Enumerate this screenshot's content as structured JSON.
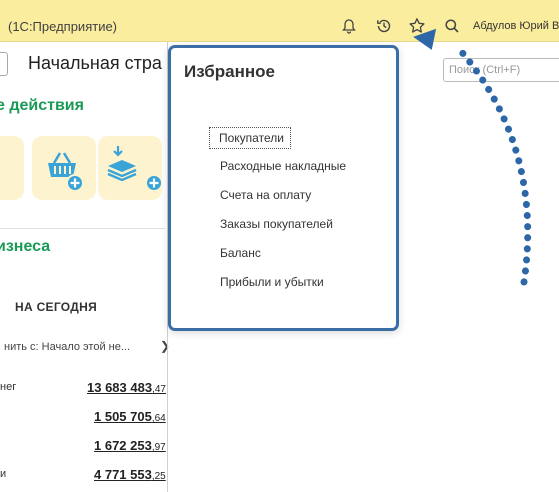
{
  "window": {
    "title": "(1С:Предприятие)",
    "user": "Абдулов Юрий В"
  },
  "toolbar": {
    "icons": [
      "bell-icon",
      "history-icon",
      "star-icon",
      "search-icon"
    ]
  },
  "search": {
    "placeholder": "Поиск (Ctrl+F)"
  },
  "home": {
    "page_title": "Начальная стра",
    "section_actions": "е действия",
    "section_business": "изнеса",
    "today_label": "НА СЕГОДНЯ",
    "period": "нить с: Начало этой не...",
    "rows": [
      {
        "label": "нег",
        "int": "13 683 483",
        "dec": ",47"
      },
      {
        "label": "",
        "int": "1 505 705",
        "dec": ",64"
      },
      {
        "label": "",
        "int": "1 672 253",
        "dec": ",97"
      },
      {
        "label": "и",
        "int": "4 771 553",
        "dec": ",25"
      }
    ]
  },
  "favorites": {
    "title": "Избранное",
    "items": [
      "Покупатели",
      "Расходные накладные",
      "Счета на оплату",
      "Заказы покупателей",
      "Баланс",
      "Прибыли и убытки"
    ]
  },
  "colors": {
    "titlebar_bg": "#fbed9e",
    "accent_green": "#1a9a56",
    "popup_border": "#3a6ea5",
    "annotation_arrow": "#2e67a8"
  }
}
